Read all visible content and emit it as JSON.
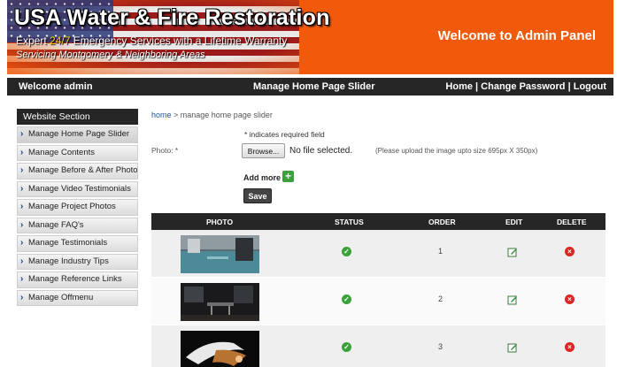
{
  "header": {
    "brand": "USA Water & Fire Restoration",
    "tagline_pre": "Expert ",
    "tagline_hl": "24/7",
    "tagline_post": " Emergency Services with a Lifetime Warranty",
    "service_area": "Servicing Montgomery & Neighboring Areas",
    "panel_title": "Welcome to Admin Panel"
  },
  "navbar": {
    "welcome": "Welcome admin",
    "page_title": "Manage Home Page Slider",
    "home": "Home",
    "sep1": " | ",
    "change_password": "Change Password",
    "sep2": " | ",
    "logout": "Logout"
  },
  "sidebar": {
    "heading": "Website Section",
    "items": [
      {
        "label": "Manage Home Page Slider"
      },
      {
        "label": "Manage Contents"
      },
      {
        "label": "Manage Before & After Photos"
      },
      {
        "label": "Manage Video Testimonials"
      },
      {
        "label": "Manage Project Photos"
      },
      {
        "label": "Manage FAQ's"
      },
      {
        "label": "Manage Testimonials"
      },
      {
        "label": "Manage Industry Tips"
      },
      {
        "label": "Manage Reference Links"
      },
      {
        "label": "Manage Offmenu"
      }
    ]
  },
  "breadcrumb": {
    "home": "home",
    "rest": " > manage home page slider"
  },
  "form": {
    "required_note": "* indicates required field",
    "photo_label": "Photo: *",
    "browse": "Browse...",
    "no_file": "No file selected.",
    "hint": "(Please upload the image upto size 695px X 350px)",
    "add_more": "Add more",
    "save": "Save"
  },
  "table": {
    "headers": {
      "photo": "PHOTO",
      "status": "STATUS",
      "order": "ORDER",
      "edit": "EDIT",
      "delete": "DELETE"
    },
    "rows": [
      {
        "order": "1"
      },
      {
        "order": "2"
      },
      {
        "order": "3"
      }
    ]
  },
  "colors": {
    "accent": "#f05a0a",
    "bar": "#262626",
    "status_ok": "#3aa23a",
    "delete": "#e02424"
  }
}
